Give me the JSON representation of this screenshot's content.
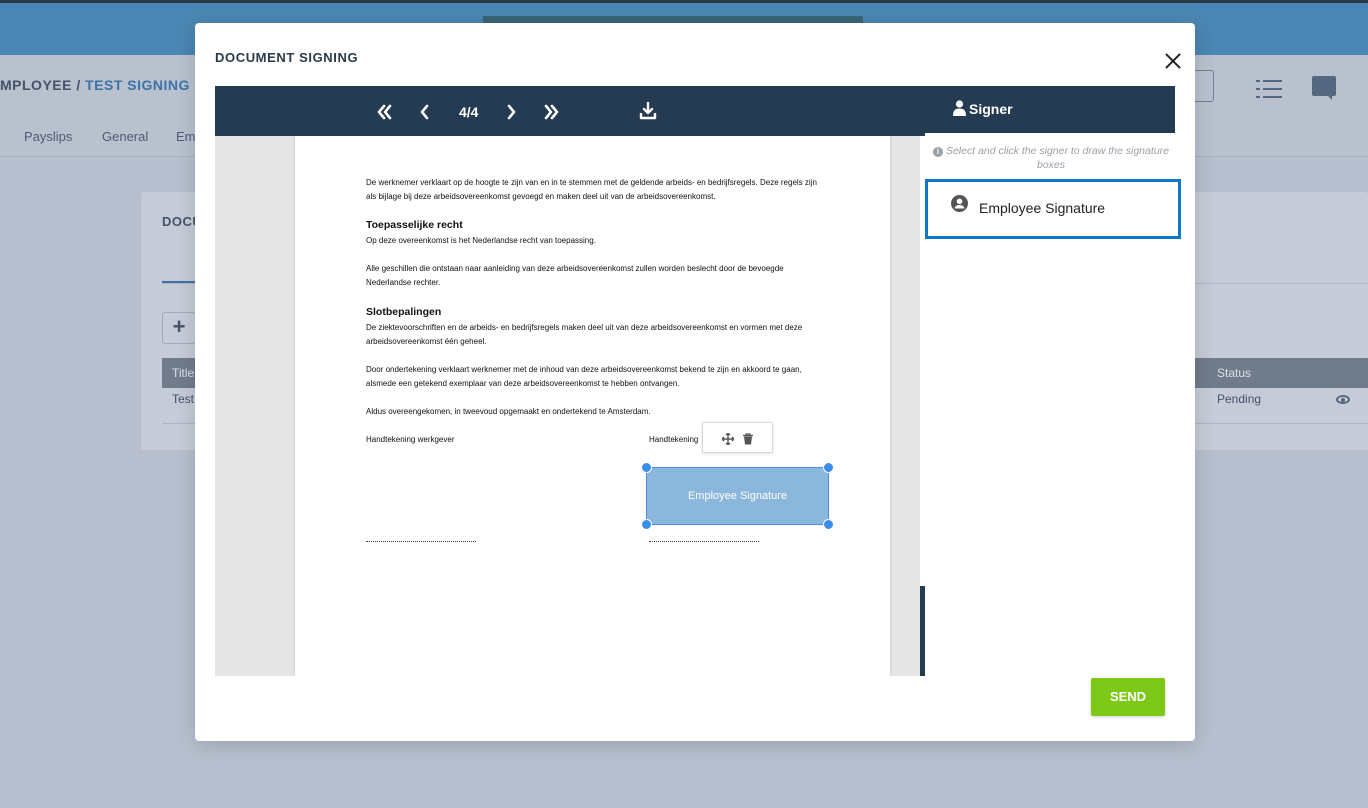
{
  "background": {
    "breadcrumb_prefix": "MPLOYEE /",
    "breadcrumb_current": "TEST SIGNING",
    "tabs": [
      "Payslips",
      "General",
      "Em"
    ],
    "card_title": "DOCU",
    "table": {
      "headers": {
        "title": "Title",
        "status": "Status"
      },
      "row": {
        "title": "Test",
        "status": "Pending"
      }
    }
  },
  "modal": {
    "title": "DOCUMENT SIGNING",
    "toolbar": {
      "page_indicator": "4/4"
    },
    "document": {
      "para1": "De werknemer verklaart op de hoogte te zijn van en in te stemmen met de geldende arbeids- en bedrijfsregels. Deze regels zijn als bijlage bij deze arbeidsovereenkomst gevoegd en maken deel uit van de arbeidsovereenkomst.",
      "heading1": "Toepasselijke recht",
      "para2": "Op deze overeenkomst is het Nederlandse recht van toepassing.",
      "para3": "Alle geschillen die ontstaan naar aanleiding van deze arbeidsovereenkomst zullen worden beslecht door de bevoegde Nederlandse rechter.",
      "heading2": "Slotbepalingen",
      "para4": "De ziektevoorschriften en de arbeids- en bedrijfsregels maken deel uit van deze arbeidsovereenkomst en vormen met deze arbeidsovereenkomst één geheel.",
      "para5": "Door ondertekening verklaart werknemer met de inhoud van deze arbeidsovereenkomst bekend te zijn en akkoord te gaan, alsmede een getekend exemplaar van deze arbeidsovereenkomst te hebben ontvangen.",
      "para6": "Aldus overeengekomen, in tweevoud opgemaakt en ondertekend te Amsterdam.",
      "sign_employer": "Handtekening werkgever",
      "sign_employee": "Handtekening"
    },
    "signature_box_label": "Employee Signature",
    "signer_panel": {
      "header": "Signer",
      "hint": "Select and click the signer to draw the signature boxes",
      "signers": [
        {
          "label": "Employee Signature"
        }
      ]
    },
    "send_label": "SEND"
  },
  "colors": {
    "toolbar_bg": "#253b52",
    "signer_selected_border": "#0e7ac7",
    "signature_box_fill": "#8cb7dc",
    "send_button": "#7ec817"
  },
  "icons": [
    "first-page-icon",
    "prev-page-icon",
    "next-page-icon",
    "last-page-icon",
    "download-icon",
    "close-icon",
    "user-icon",
    "info-icon",
    "user-circle-icon",
    "move-icon",
    "trash-icon"
  ]
}
